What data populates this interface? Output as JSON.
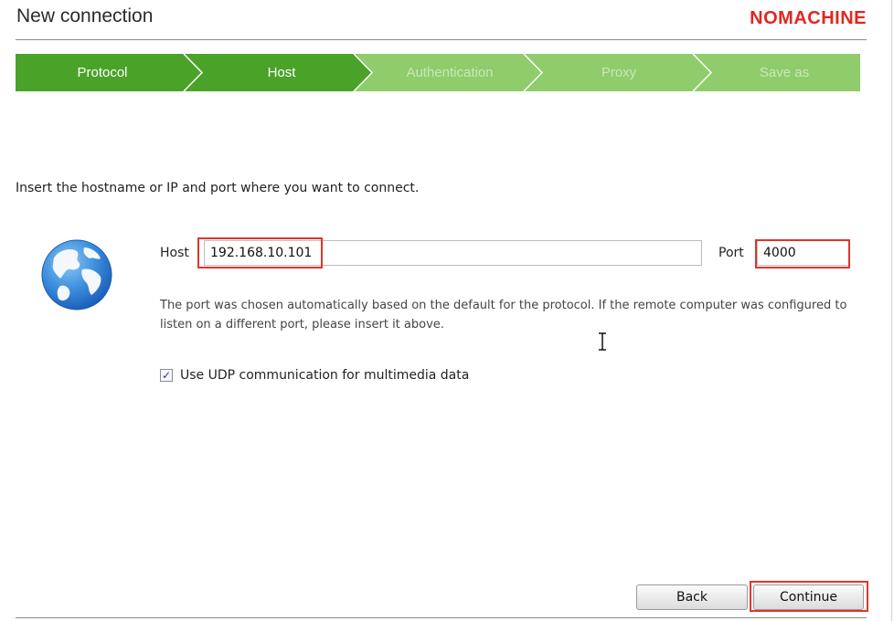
{
  "window": {
    "title": "New connection",
    "logo": "NOMACHINE"
  },
  "colors": {
    "step_done": "#4aa229",
    "step_todo": "#8fcc6b",
    "highlight_box": "#e0352b",
    "logo_red": "#e3261f"
  },
  "wizard": {
    "steps": [
      {
        "label": "Protocol",
        "state": "done"
      },
      {
        "label": "Host",
        "state": "current"
      },
      {
        "label": "Authentication",
        "state": "todo"
      },
      {
        "label": "Proxy",
        "state": "todo"
      },
      {
        "label": "Save as",
        "state": "todo"
      }
    ]
  },
  "form": {
    "instruction": "Insert the hostname or IP and port where you want to connect.",
    "host_label": "Host",
    "host_value": "192.168.10.101",
    "port_label": "Port",
    "port_value": "4000",
    "help_line_1": "The port was chosen automatically based on the default for the protocol. If the remote computer was configured to",
    "help_line_2": "listen on a different port, please insert it above.",
    "udp_label": "Use UDP communication for multimedia data",
    "udp_checked": true,
    "globe_icon": "globe-icon",
    "checkbox_mark": "✓"
  },
  "buttons": {
    "back": "Back",
    "continue": "Continue"
  }
}
